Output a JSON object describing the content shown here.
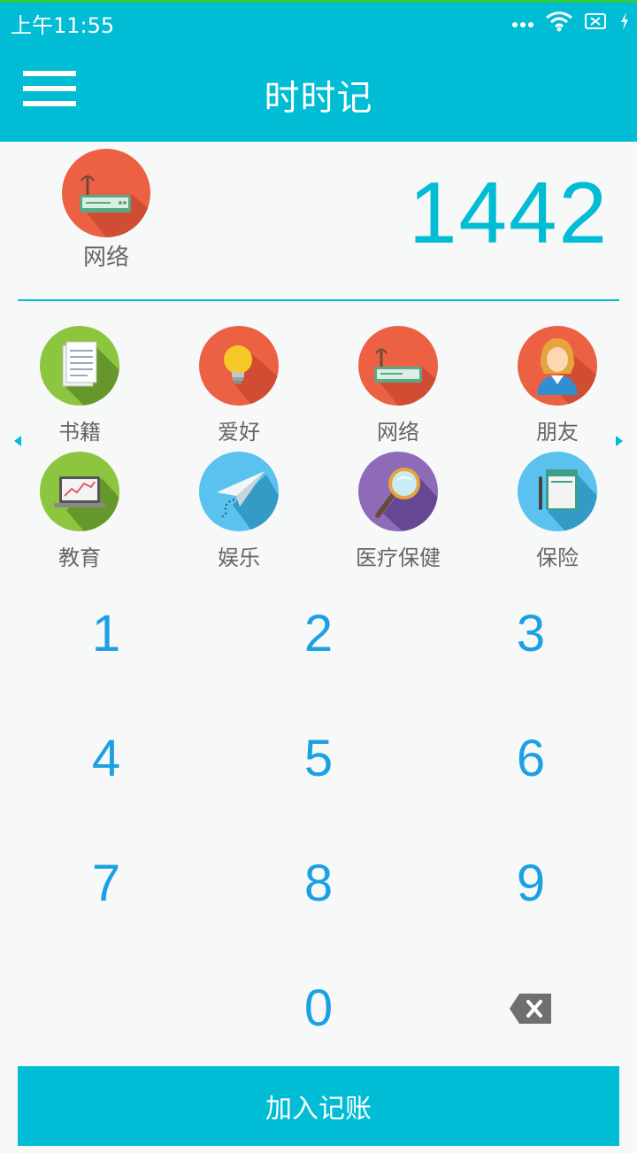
{
  "status_bar": {
    "time": "上午11:55"
  },
  "app": {
    "title": "时时记"
  },
  "selected": {
    "label": "网络",
    "amount": "1442"
  },
  "categories": [
    {
      "label": "书籍",
      "icon": "notebook-icon",
      "color": "#8cc63f"
    },
    {
      "label": "爱好",
      "icon": "lightbulb-icon",
      "color": "#ec6144"
    },
    {
      "label": "网络",
      "icon": "router-icon",
      "color": "#ec6144"
    },
    {
      "label": "朋友",
      "icon": "person-icon",
      "color": "#ec6144"
    },
    {
      "label": "教育",
      "icon": "laptop-chart-icon",
      "color": "#8cc63f"
    },
    {
      "label": "娱乐",
      "icon": "paper-plane-icon",
      "color": "#5bc2f0"
    },
    {
      "label": "医疗保健",
      "icon": "magnifier-icon",
      "color": "#8e6bb8"
    },
    {
      "label": "保险",
      "icon": "notebook-pen-icon",
      "color": "#5bc2f0"
    }
  ],
  "keypad": {
    "k1": "1",
    "k2": "2",
    "k3": "3",
    "k4": "4",
    "k5": "5",
    "k6": "6",
    "k7": "7",
    "k8": "8",
    "k9": "9",
    "k0": "0"
  },
  "actions": {
    "submit_label": "加入记账"
  },
  "colors": {
    "primary": "#00bcd4",
    "key_text": "#1ca0e4"
  }
}
